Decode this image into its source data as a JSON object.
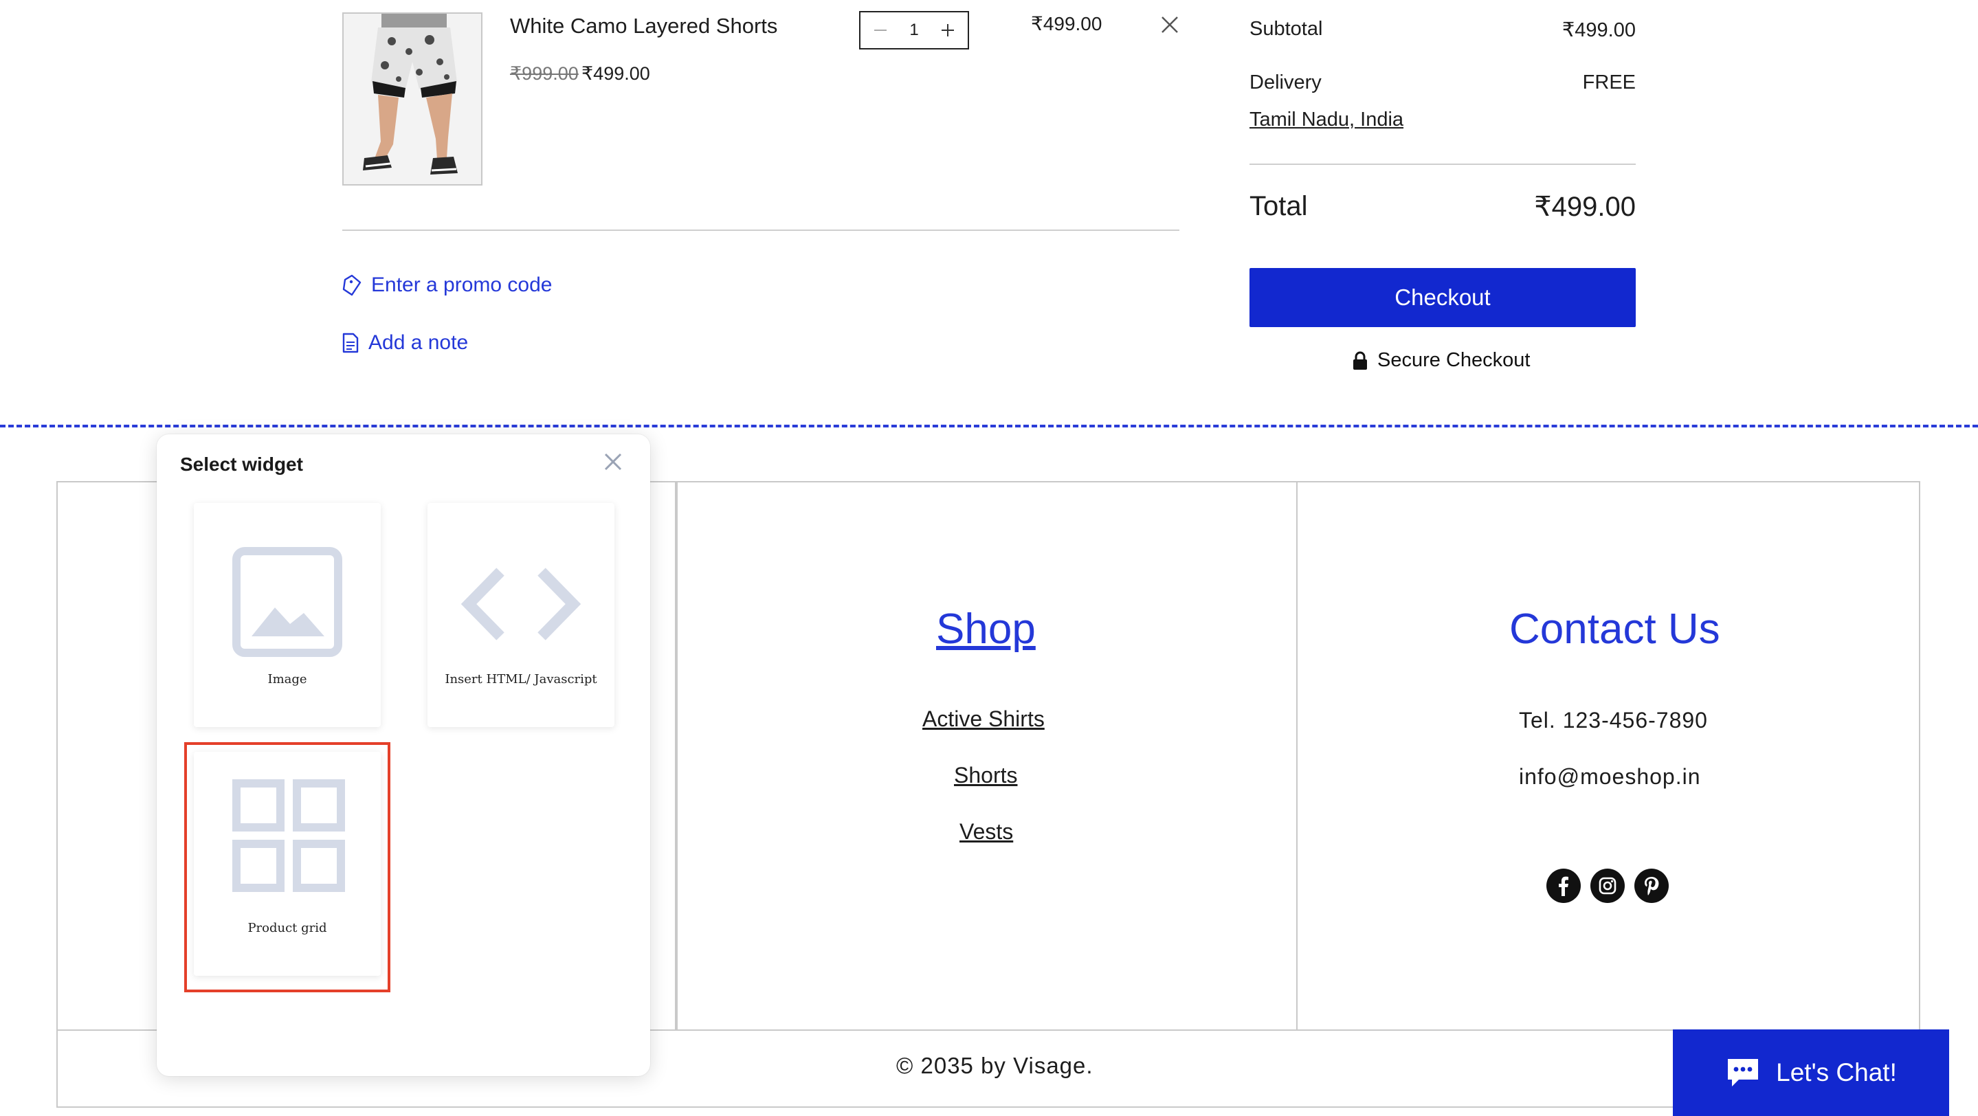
{
  "cart": {
    "item": {
      "name": "White Camo Layered Shorts",
      "original_price": "₹999.00",
      "sale_price": "₹499.00",
      "quantity": "1",
      "line_total": "₹499.00"
    },
    "promo_link": "Enter a promo code",
    "note_link": "Add a note"
  },
  "summary": {
    "subtotal_label": "Subtotal",
    "subtotal_value": "₹499.00",
    "delivery_label": "Delivery",
    "delivery_value": "FREE",
    "delivery_region": "Tamil Nadu, India",
    "total_label": "Total",
    "total_value": "₹499.00",
    "checkout_label": "Checkout",
    "secure_label": "Secure Checkout"
  },
  "widget_panel": {
    "title": "Select widget",
    "options": [
      {
        "label": "Image",
        "icon": "image-icon"
      },
      {
        "label": "Insert HTML/ Javascript",
        "icon": "code-icon"
      },
      {
        "label": "Product grid",
        "icon": "grid-icon",
        "selected": true
      }
    ]
  },
  "footer": {
    "shop_title": "Shop",
    "shop_links": [
      "Active Shirts",
      "Shorts",
      "Vests"
    ],
    "contact_title": "Contact Us",
    "phone": "Tel. 123-456-7890",
    "email": "info@moeshop.in",
    "social": [
      "facebook-icon",
      "instagram-icon",
      "pinterest-icon"
    ],
    "copyright": "© 2035 by Visage."
  },
  "chat": {
    "label": "Let's Chat!"
  },
  "colors": {
    "accent": "#1228cf",
    "link": "#2438d8",
    "highlight": "#e4402a"
  }
}
